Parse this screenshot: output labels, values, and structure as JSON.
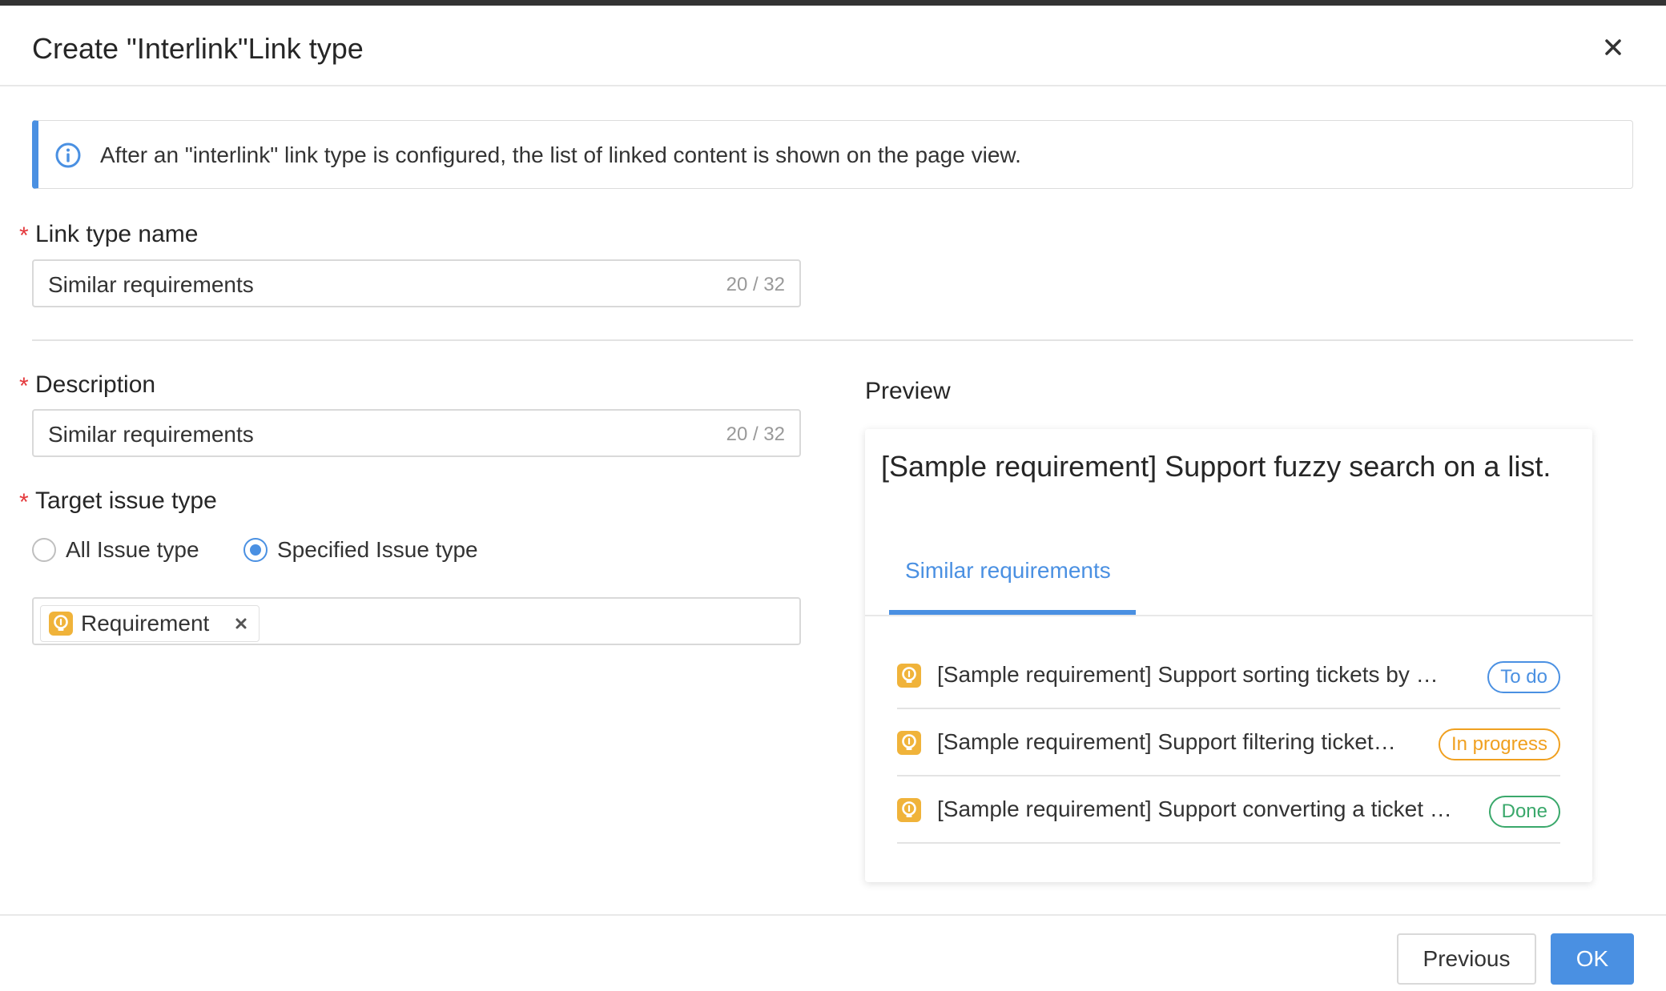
{
  "dialog": {
    "title": "Create \"Interlink\"Link type",
    "close_icon": "close-icon"
  },
  "alert": {
    "icon": "info-icon",
    "text": "After an \"interlink\" link type is configured, the list of linked content is shown on the page view.",
    "accent_color": "#4a90e2"
  },
  "form": {
    "required_mark": "*",
    "link_type_name": {
      "label": "Link type name",
      "value": "Similar requirements",
      "counter": "20 / 32"
    },
    "description": {
      "label": "Description",
      "value": "Similar requirements",
      "counter": "20 / 32"
    },
    "target_issue_type": {
      "label": "Target issue type",
      "options": [
        {
          "label": "All Issue type",
          "checked": false
        },
        {
          "label": "Specified Issue type",
          "checked": true
        }
      ],
      "selected_tags": [
        {
          "label": "Requirement",
          "icon": "lightbulb-icon"
        }
      ],
      "remove_icon": "close-icon"
    }
  },
  "preview": {
    "label": "Preview",
    "title": "[Sample requirement] Support fuzzy search on a list.",
    "tab": "Similar requirements",
    "items": [
      {
        "text": "[Sample requirement] Support sorting tickets by …",
        "status": "To do",
        "status_color": "#4a90e2"
      },
      {
        "text": "[Sample requirement] Support filtering ticket…",
        "status": "In progress",
        "status_color": "#f0a020"
      },
      {
        "text": "[Sample requirement] Support converting a ticket …",
        "status": "Done",
        "status_color": "#3aa86b"
      }
    ]
  },
  "footer": {
    "previous_label": "Previous",
    "ok_label": "OK",
    "primary_color": "#4a90e2"
  }
}
